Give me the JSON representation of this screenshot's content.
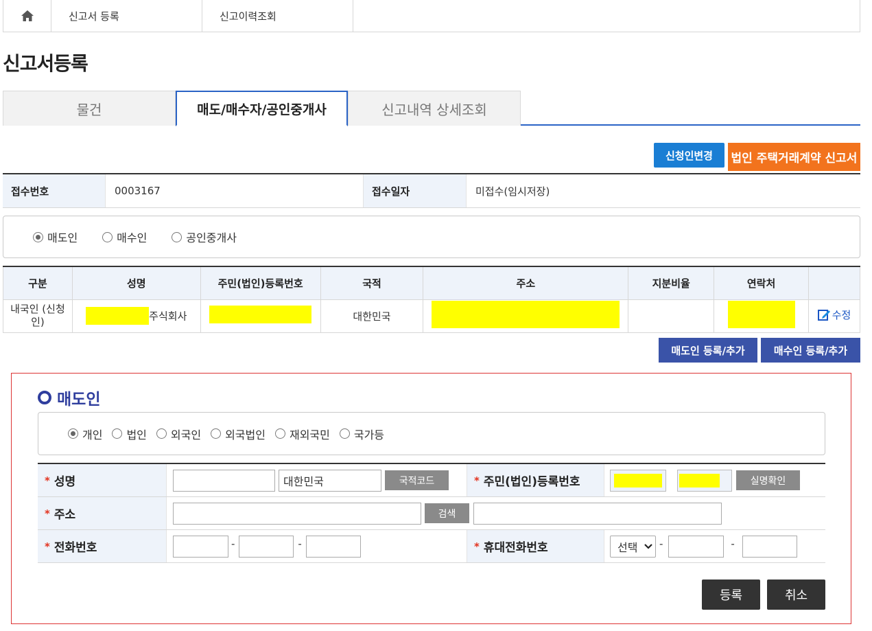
{
  "topnav": {
    "home_icon": "home-icon",
    "items": [
      "신고서 등록",
      "신고이력조회"
    ]
  },
  "page_title": "신고서등록",
  "tabs": [
    "물건",
    "매도/매수자/공인중개사",
    "신고내역 상세조회"
  ],
  "actions": {
    "change_applicant": "신청인변경",
    "corporate_report": "법인 주택거래계약 신고서"
  },
  "receipt": {
    "no_label": "접수번호",
    "no_value": "0003167",
    "date_label": "접수일자",
    "date_value": "미접수(임시저장)"
  },
  "party_radios": [
    "매도인",
    "매수인",
    "공인중개사"
  ],
  "persons": {
    "headers": [
      "구분",
      "성명",
      "주민(법인)등록번호",
      "국적",
      "주소",
      "지분비율",
      "연락처",
      ""
    ],
    "row": {
      "type": "내국인 (신청인)",
      "name_suffix": "주식회사",
      "nationality": "대한민국",
      "edit_label": "수정"
    }
  },
  "add_buttons": {
    "seller": "매도인 등록/추가",
    "buyer": "매수인 등록/추가"
  },
  "seller_form": {
    "title": "매도인",
    "type_radios": [
      "개인",
      "법인",
      "외국인",
      "외국법인",
      "재외국민",
      "국가등"
    ],
    "name_label": "성명",
    "nationality_value": "대한민국",
    "nation_code_btn": "국적코드",
    "regno_label": "주민(법인)등록번호",
    "verify_btn": "실명확인",
    "address_label": "주소",
    "search_btn": "검색",
    "phone_label": "전화번호",
    "mobile_label": "휴대전화번호",
    "mobile_select": "선택",
    "dash": "-"
  },
  "form_buttons": {
    "register": "등록",
    "cancel": "취소"
  },
  "colors": {
    "accent_blue": "#2a63c6",
    "orange": "#f2731d",
    "navy": "#3a53a8",
    "highlight": "#ffff00"
  }
}
